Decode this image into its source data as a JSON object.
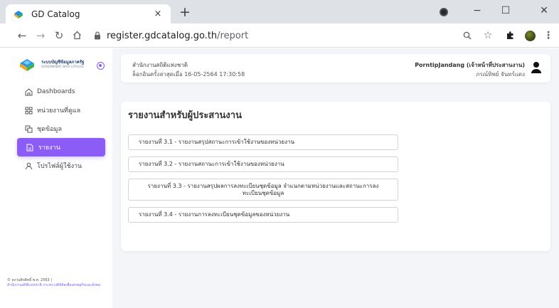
{
  "browser": {
    "tab_title": "GD Catalog",
    "tab_close": "×",
    "new_tab": "+",
    "url_host": "register.gdcatalog.go.th",
    "url_path": "/report",
    "minimize": "−",
    "maximize": "☐",
    "close": "✕"
  },
  "sidebar": {
    "brand_line1": "ระบบบัญชีข้อมูลภาครัฐ",
    "brand_line2": "GOVERNMENT DATA CATALOG",
    "items": [
      {
        "label": "Dashboards",
        "icon": "home-icon"
      },
      {
        "label": "หน่วยงานที่ดูแล",
        "icon": "grid-icon"
      },
      {
        "label": "ชุดข้อมูล",
        "icon": "dataset-icon"
      },
      {
        "label": "รายงาน",
        "icon": "report-icon",
        "active": true
      },
      {
        "label": "โปรไฟล์ผู้ใช้งาน",
        "icon": "user-icon"
      }
    ],
    "copyright_line1": "© สงวนลิขสิทธิ์ พ.ศ. 2563 |",
    "copyright_line2": "สำนักงานสถิติแห่งชาติ กระทรวงดิจิทัลเพื่อเศรษฐกิจและสังคม"
  },
  "header": {
    "agency": "สำนักงานสถิติแห่งชาติ",
    "last_login": "ล็อกอินครั้งล่าสุดเมื่อ 16-05-2564 17:30:58",
    "user_name": "PorntipJandang (เจ้าหน้าที่ประสานงาน)",
    "user_sub": "ภรณ์ทิพย์ จันทร์แดง"
  },
  "main": {
    "title": "รายงานสำหรับผู้ประสานงาน",
    "reports": [
      "รายงานที่ 3.1 - รายงานสรุปสถานะการเข้าใช้งานของหน่วยงาน",
      "รายงานที่ 3.2 - รายงานสถานะการเข้าใช้งานของหน่วยงาน",
      "รายงานที่ 3.3 - รายงานสรุปผลการลงทะเบียนชุดข้อมูล จำแนกตามหน่วยงานและสถานะการลงทะเบียนชุดข้อมูล",
      "รายงานที่ 3.4 - รายงานการลงทะเบียนชุดข้อมูลของหน่วยงาน"
    ]
  },
  "colors": {
    "accent": "#8b5cf6",
    "tabbar": "#dee1e6",
    "app_bg": "#f4f5f8"
  }
}
